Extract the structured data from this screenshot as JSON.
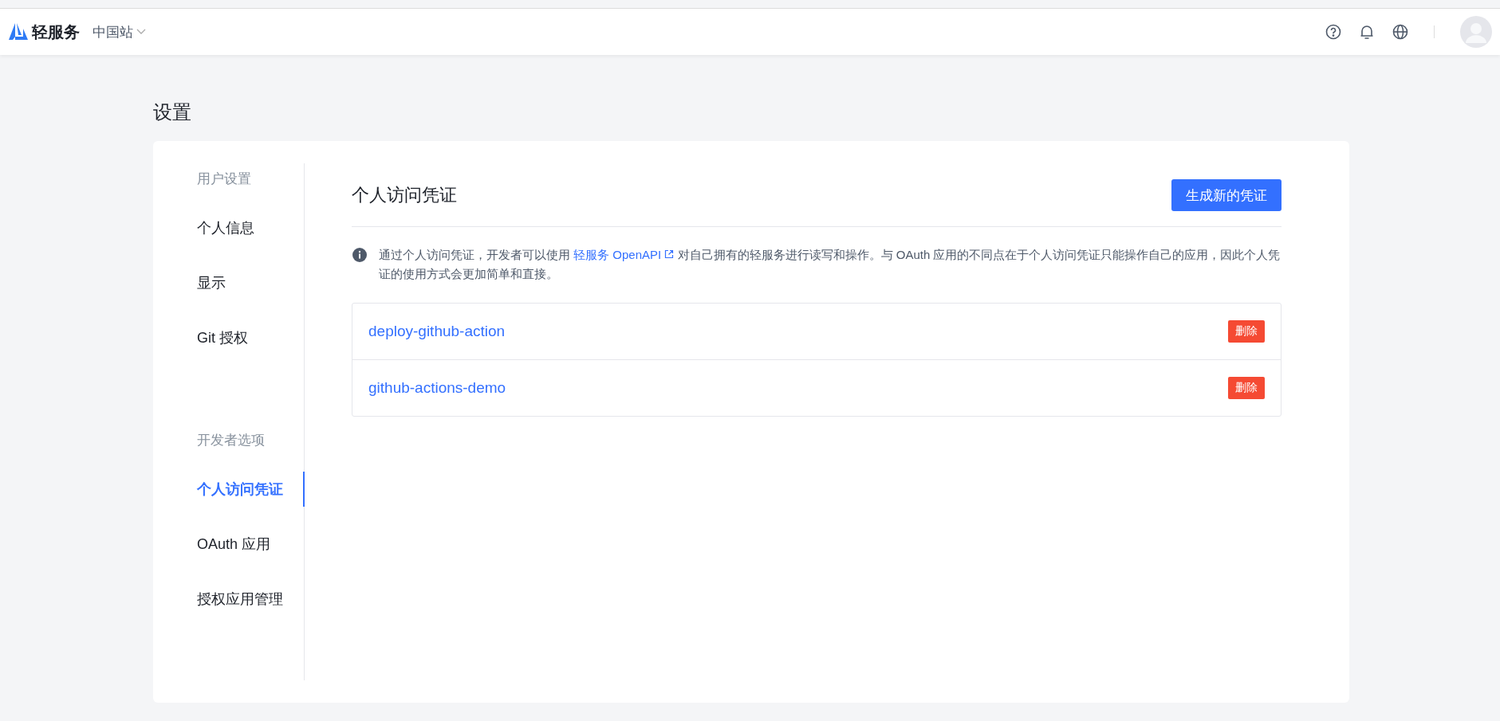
{
  "header": {
    "brand": "轻服务",
    "site": "中国站"
  },
  "page_title": "设置",
  "sidebar": {
    "groups": [
      {
        "heading": "用户设置",
        "items": [
          {
            "label": "个人信息",
            "selected": false
          },
          {
            "label": "显示",
            "selected": false
          },
          {
            "label": "Git 授权",
            "selected": false
          }
        ]
      },
      {
        "heading": "开发者选项",
        "items": [
          {
            "label": "个人访问凭证",
            "selected": true
          },
          {
            "label": "OAuth 应用",
            "selected": false
          },
          {
            "label": "授权应用管理",
            "selected": false
          }
        ]
      }
    ]
  },
  "content": {
    "title": "个人访问凭证",
    "primary_button": "生成新的凭证",
    "info": {
      "before": "通过个人访问凭证，开发者可以使用 ",
      "link": "轻服务 OpenAPI",
      "after": " 对自己拥有的轻服务进行读写和操作。与 OAuth 应用的不同点在于个人访问凭证只能操作自己的应用，因此个人凭证的使用方式会更加简单和直接。"
    },
    "tokens": [
      {
        "name": "deploy-github-action",
        "action": "删除"
      },
      {
        "name": "github-actions-demo",
        "action": "删除"
      }
    ]
  }
}
